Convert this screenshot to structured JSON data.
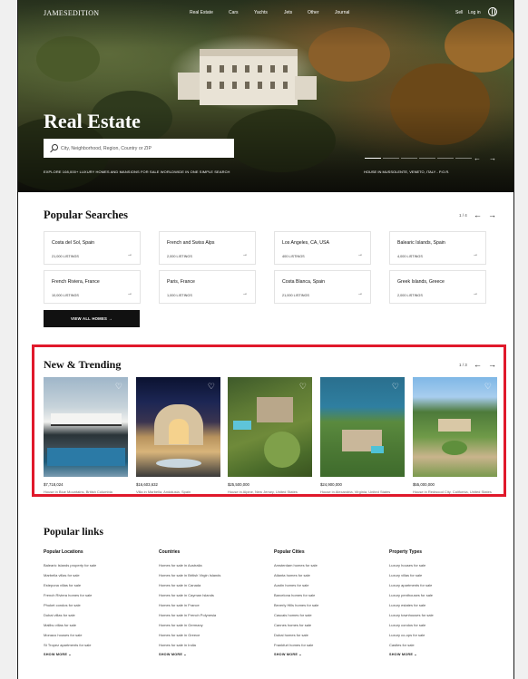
{
  "header": {
    "logo": "JAMESEDITION",
    "nav": [
      "Real Estate",
      "Cars",
      "Yachts",
      "Jets",
      "Other",
      "Journal"
    ],
    "sell": "Sell",
    "login": "Log in",
    "globe_icon": "globe-icon"
  },
  "hero": {
    "title": "Real Estate",
    "search_placeholder": "City, Neighborhood, Region, Country or ZIP",
    "tagline": "EXPLORE 108,000+ LUXURY HOMES AND MANSIONS FOR SALE WORLDWIDE IN ONE SIMPLE SEARCH",
    "caption": "HOUSE IN MUSSOLENTE, VENETO, ITALY - P.O.R.",
    "prev": "←",
    "next": "→"
  },
  "popular_searches": {
    "title": "Popular Searches",
    "pager": "1 / 4",
    "prev": "←",
    "next": "→",
    "cards": [
      {
        "name": "Costa del Sol, Spain",
        "count": "21,000 LISTINGS",
        "arrow": "→"
      },
      {
        "name": "French and Swiss Alps",
        "count": "2,000 LISTINGS",
        "arrow": "→"
      },
      {
        "name": "Los Angeles, CA, USA",
        "count": "400 LISTINGS",
        "arrow": "→"
      },
      {
        "name": "Balearic Islands, Spain",
        "count": "4,000 LISTINGS",
        "arrow": "→"
      },
      {
        "name": "French Riviera, France",
        "count": "10,000 LISTINGS",
        "arrow": "→"
      },
      {
        "name": "Paris, France",
        "count": "1,000 LISTINGS",
        "arrow": "→"
      },
      {
        "name": "Costa Blanca, Spain",
        "count": "21,000 LISTINGS",
        "arrow": "→"
      },
      {
        "name": "Greek Islands, Greece",
        "count": "2,000 LISTINGS",
        "arrow": "→"
      }
    ],
    "view_all": "VIEW ALL HOMES  →"
  },
  "trending": {
    "title": "New & Trending",
    "pager": "1 / 3",
    "prev": "←",
    "next": "→",
    "heart": "♡",
    "items": [
      {
        "price": "$7,718,024",
        "location": "House in Blue Mountains, British Columbia"
      },
      {
        "price": "$16,603,632",
        "location": "Villa in Marbella, Andalusia, Spain"
      },
      {
        "price": "$25,500,000",
        "location": "House in Alpine, New Jersey, United States"
      },
      {
        "price": "$24,900,000",
        "location": "House in Alexandria, Virginia, United States"
      },
      {
        "price": "$55,000,000",
        "location": "House in Redwood City, California, United States"
      }
    ]
  },
  "popular_links": {
    "title": "Popular links",
    "columns": [
      {
        "heading": "Popular Locations",
        "links": [
          "Balearic Islands property for sale",
          "Marbella villas for sale",
          "Estepona villas for sale",
          "French Riviera homes for sale",
          "Phuket condos for sale",
          "Dubai villas for sale",
          "Malibu villas for sale",
          "Monaco houses for sale",
          "St Tropez apartments for sale"
        ],
        "more": "SHOW MORE ⌄"
      },
      {
        "heading": "Countries",
        "links": [
          "Homes for sale in Australia",
          "Homes for sale in British Virgin Islands",
          "Homes for sale in Canada",
          "Homes for sale in Cayman Islands",
          "Homes for sale in France",
          "Homes for sale in French Polynesia",
          "Homes for sale in Germany",
          "Homes for sale in Greece",
          "Homes for sale in India"
        ],
        "more": "SHOW MORE ⌄"
      },
      {
        "heading": "Popular Cities",
        "links": [
          "Amsterdam homes for sale",
          "Atlanta homes for sale",
          "Austin homes for sale",
          "Barcelona homes for sale",
          "Beverly Hills homes for sale",
          "Cascais homes for sale",
          "Cannes homes for sale",
          "Dubai homes for sale",
          "Frankfurt homes for sale"
        ],
        "more": "SHOW MORE ⌄"
      },
      {
        "heading": "Property Types",
        "links": [
          "Luxury houses for sale",
          "Luxury villas for sale",
          "Luxury apartments for sale",
          "Luxury penthouses for sale",
          "Luxury estates for sale",
          "Luxury townhouses for sale",
          "Luxury condos for sale",
          "Luxury co-ops for sale",
          "Castles for sale"
        ],
        "more": "SHOW MORE ⌄"
      }
    ]
  }
}
